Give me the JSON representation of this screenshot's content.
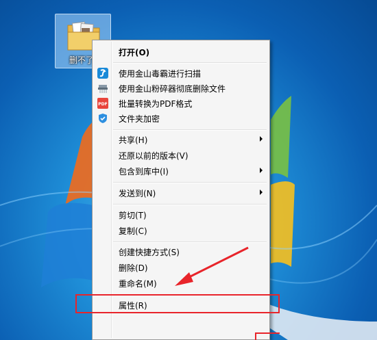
{
  "desktop_icon": {
    "label": "删不了"
  },
  "menu": {
    "open": "打开(O)",
    "scan": "使用金山毒霸进行扫描",
    "shred": "使用金山粉碎器彻底删除文件",
    "pdf": "批量转换为PDF格式",
    "encrypt": "文件夹加密",
    "share": "共享(H)",
    "restore": "还原以前的版本(V)",
    "library": "包含到库中(I)",
    "sendto": "发送到(N)",
    "cut": "剪切(T)",
    "copy": "复制(C)",
    "shortcut": "创建快捷方式(S)",
    "delete": "删除(D)",
    "rename": "重命名(M)",
    "properties": "属性(R)"
  },
  "icons": {
    "scan": "kingsoft-antivirus-icon",
    "shred": "shredder-icon",
    "pdf": "pdf-icon",
    "encrypt": "shield-icon"
  },
  "colors": {
    "annotation": "#e8242a",
    "pdf_badge": "#e8453c",
    "scan_badge": "#1a8ad8"
  }
}
